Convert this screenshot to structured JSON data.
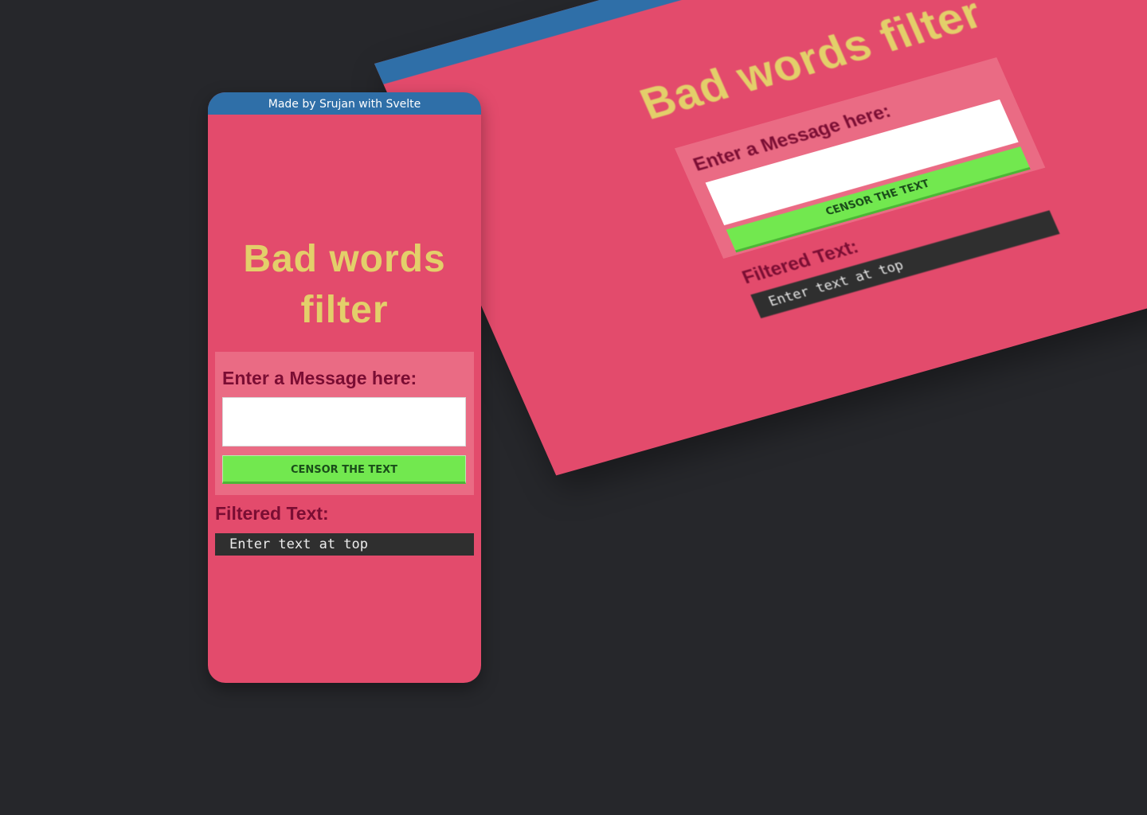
{
  "app": {
    "credit": "Made by Srujan with Svelte",
    "title": "Bad words filter",
    "title_line1": "Bad words",
    "title_line2": "filter"
  },
  "form": {
    "label": "Enter a Message here:",
    "input_value": "",
    "button_label": "CENSOR THE TEXT"
  },
  "output": {
    "label": "Filtered Text:",
    "text": "Enter text at top"
  },
  "colors": {
    "page_background": "#26272b",
    "app_background": "#e34b6c",
    "header_bar": "#2f6fa8",
    "title": "#e3cf6a",
    "card": "#ea6b84",
    "label_text": "#7a0d33",
    "button": "#72e84f",
    "output_background": "#2f2f2f"
  }
}
